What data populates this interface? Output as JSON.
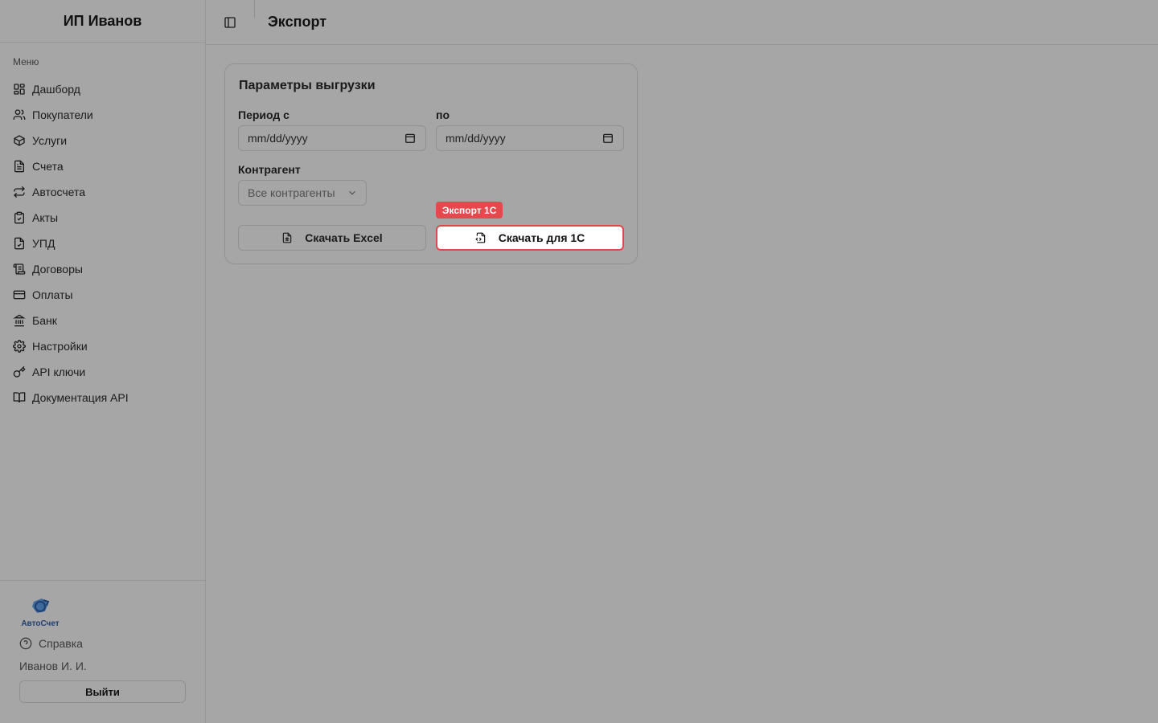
{
  "sidebar": {
    "brand": "ИП Иванов",
    "menu_caption": "Меню",
    "items": [
      {
        "label": "Дашборд",
        "icon": "dashboard-icon"
      },
      {
        "label": "Покупатели",
        "icon": "users-icon"
      },
      {
        "label": "Услуги",
        "icon": "box-icon"
      },
      {
        "label": "Счета",
        "icon": "file-text-icon"
      },
      {
        "label": "Автосчета",
        "icon": "repeat-icon"
      },
      {
        "label": "Акты",
        "icon": "clipboard-check-icon"
      },
      {
        "label": "УПД",
        "icon": "file-check-icon"
      },
      {
        "label": "Договоры",
        "icon": "scroll-icon"
      },
      {
        "label": "Оплаты",
        "icon": "credit-card-icon"
      },
      {
        "label": "Банк",
        "icon": "bank-icon"
      },
      {
        "label": "Настройки",
        "icon": "gear-icon"
      },
      {
        "label": "API ключи",
        "icon": "key-icon"
      },
      {
        "label": "Документация API",
        "icon": "book-icon"
      }
    ],
    "footer": {
      "logo_text": "АвтоСчет",
      "help_label": "Справка",
      "user_name": "Иванов И. И.",
      "logout_label": "Выйти"
    }
  },
  "header": {
    "title": "Экспорт"
  },
  "export_card": {
    "title": "Параметры выгрузки",
    "period_from_label": "Период с",
    "period_to_label": "по",
    "date_from_placeholder": "mm/dd/yyyy",
    "date_to_placeholder": "mm/dd/yyyy",
    "counterparty_label": "Контрагент",
    "counterparty_value": "Все контрагенты",
    "excel_button_label": "Скачать Excel",
    "onec_button_label": "Скачать для 1С",
    "onec_badge": "Экспорт 1С"
  },
  "colors": {
    "accent_red": "#e5484d",
    "background": "#a6a6a6"
  }
}
